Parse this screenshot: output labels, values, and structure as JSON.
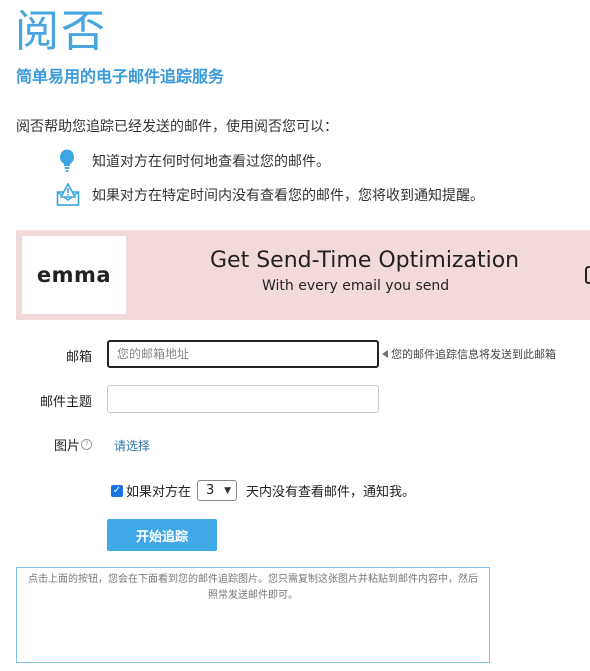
{
  "header": {
    "logo_text": "阅否",
    "tagline": "简单易用的电子邮件追踪服务"
  },
  "intro": {
    "text": "阅否帮助您追踪已经发送的邮件，使用阅否您可以：",
    "features": [
      {
        "icon": "lightbulb-icon",
        "text": "知道对方在何时何地查看过您的邮件。"
      },
      {
        "icon": "alert-mail-icon",
        "text": "如果对方在特定时间内没有查看您的邮件，您将收到通知提醒。"
      }
    ]
  },
  "banner": {
    "brand": "emma",
    "headline": "Get Send-Time Optimization",
    "subline": "With every email you send"
  },
  "form": {
    "email_label": "邮箱",
    "email_placeholder": "您的邮箱地址",
    "email_hint": "您的邮件追踪信息将发送到此邮箱",
    "subject_label": "邮件主题",
    "subject_value": "",
    "picture_label": "图片",
    "picture_help": "?",
    "choose_label": "请选择",
    "notify_checked": true,
    "notify_prefix": "如果对方在",
    "notify_days": "3",
    "notify_suffix": "天内没有查看邮件，通知我。",
    "submit_label": "开始追踪",
    "output_placeholder": "点击上面的按钮，您会在下面看到您的邮件追踪图片。您只需复制这张图片并粘贴到邮件内容中，然后照常发送邮件即可。"
  },
  "colors": {
    "brand_blue": "#48a6de",
    "button_blue": "#3ea9e6",
    "banner_bg": "#f2dada"
  }
}
